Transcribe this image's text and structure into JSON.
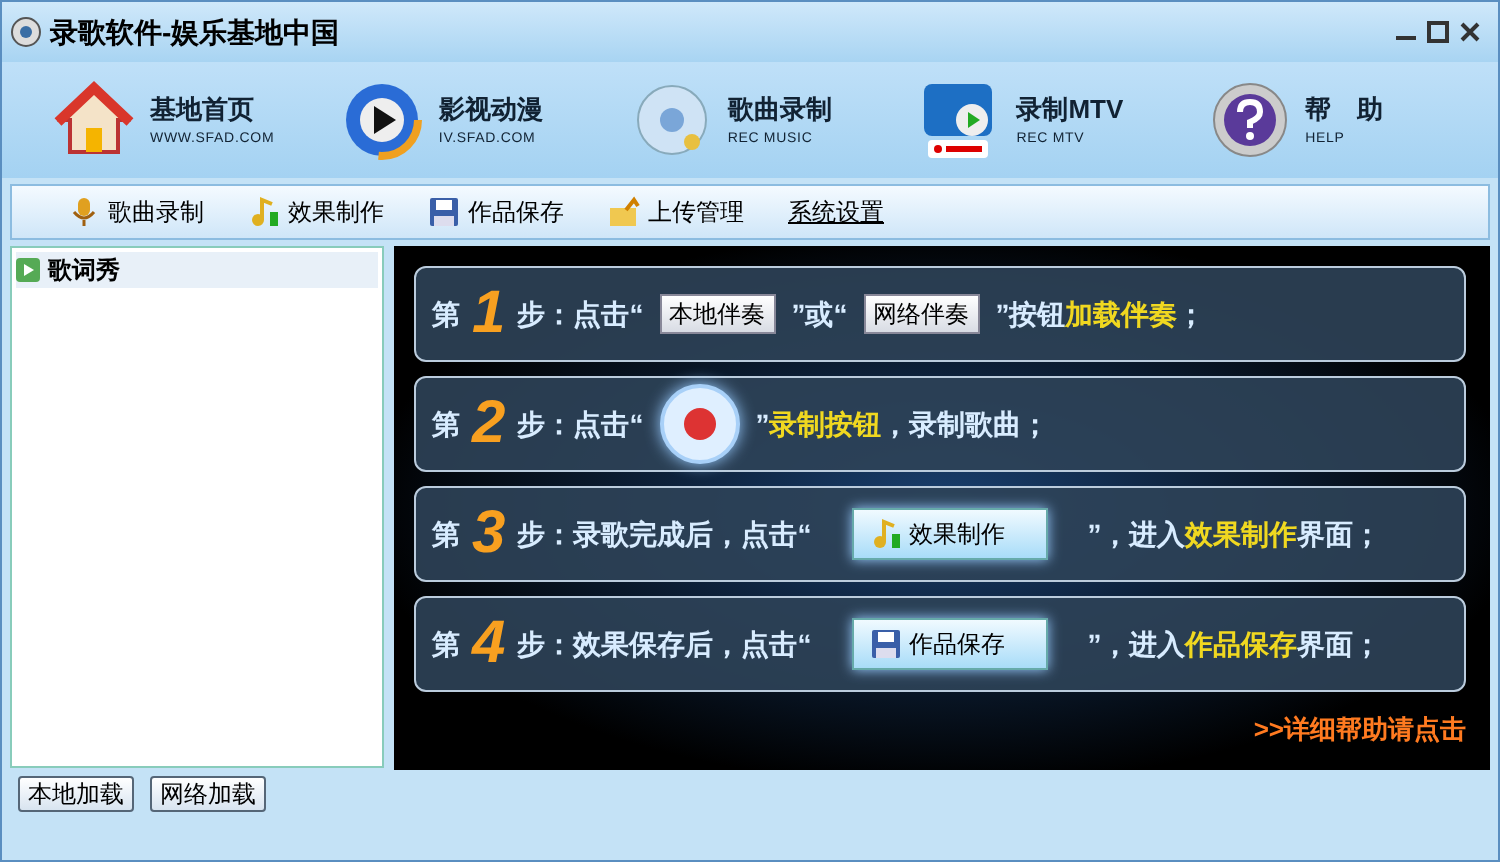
{
  "window": {
    "title": "录歌软件-娱乐基地中国"
  },
  "nav": [
    {
      "kind": "home",
      "title": "基地首页",
      "subtitle": "WWW.SFAD.COM"
    },
    {
      "kind": "video",
      "title": "影视动漫",
      "subtitle": "IV.SFAD.COM"
    },
    {
      "kind": "disc",
      "title": "歌曲录制",
      "subtitle": "REC MUSIC"
    },
    {
      "kind": "mtv",
      "title": "录制MTV",
      "subtitle": "REC MTV"
    },
    {
      "kind": "help",
      "title": "帮　助",
      "subtitle": "HELP"
    }
  ],
  "toolbar": [
    {
      "kind": "mic",
      "label": "歌曲录制",
      "link": false
    },
    {
      "kind": "effect",
      "label": "效果制作",
      "link": false
    },
    {
      "kind": "save",
      "label": "作品保存",
      "link": false
    },
    {
      "kind": "upload",
      "label": "上传管理",
      "link": false
    },
    {
      "kind": "none",
      "label": "系统设置",
      "link": true
    }
  ],
  "sidebar": {
    "items": [
      {
        "label": "歌词秀"
      }
    ],
    "buttons": [
      "本地加载",
      "网络加载"
    ]
  },
  "steps": [
    {
      "prefix": "第",
      "number": "1",
      "parts": [
        {
          "kind": "text",
          "text": "步：点击“"
        },
        {
          "kind": "button",
          "text": "本地伴奏"
        },
        {
          "kind": "text",
          "text": "”或“"
        },
        {
          "kind": "button",
          "text": "网络伴奏"
        },
        {
          "kind": "text",
          "text": "”按钮"
        },
        {
          "kind": "highlight",
          "text": "加载伴奏"
        },
        {
          "kind": "text",
          "text": "；"
        }
      ]
    },
    {
      "prefix": "第",
      "number": "2",
      "parts": [
        {
          "kind": "text",
          "text": "步：点击“"
        },
        {
          "kind": "record"
        },
        {
          "kind": "text",
          "text": "”"
        },
        {
          "kind": "highlight",
          "text": "录制按钮"
        },
        {
          "kind": "text",
          "text": "，录制歌曲；"
        }
      ]
    },
    {
      "prefix": "第",
      "number": "3",
      "parts": [
        {
          "kind": "text",
          "text": "步：录歌完成后，点击“"
        },
        {
          "kind": "effect_button",
          "text": "效果制作"
        },
        {
          "kind": "text",
          "text": "”，进入"
        },
        {
          "kind": "highlight",
          "text": "效果制作"
        },
        {
          "kind": "text",
          "text": "界面；"
        }
      ]
    },
    {
      "prefix": "第",
      "number": "4",
      "parts": [
        {
          "kind": "text",
          "text": "步：效果保存后，点击“"
        },
        {
          "kind": "save_button",
          "text": "作品保存"
        },
        {
          "kind": "text",
          "text": "”，进入"
        },
        {
          "kind": "highlight",
          "text": "作品保存"
        },
        {
          "kind": "text",
          "text": "界面；"
        }
      ]
    }
  ],
  "help_link": ">>详细帮助请点击"
}
